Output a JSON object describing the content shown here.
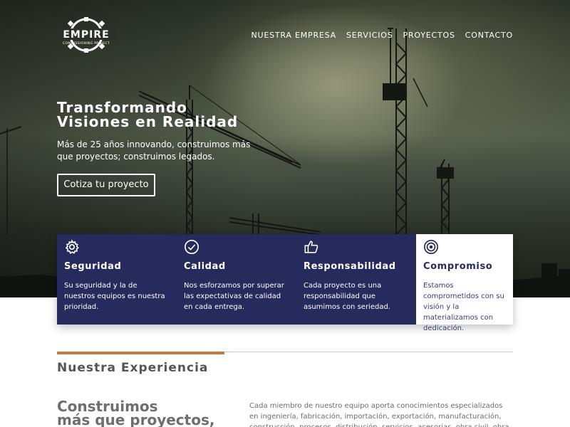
{
  "brand": {
    "logo_text": "EMPIRE",
    "logo_sub": "COMMISSIONING PROJECT"
  },
  "nav": {
    "items": [
      "NUESTRA EMPRESA",
      "SERVICIOS",
      "PROYECTOS",
      "CONTACTO"
    ]
  },
  "hero": {
    "title_line1": "Transformando",
    "title_line2": "Visiones en Realidad",
    "subtitle": "Más de 25 años innovando, construimos más que proyectos; construimos legados.",
    "cta_label": "Cotiza tu proyecto"
  },
  "features": [
    {
      "icon": "gear-icon",
      "title": "Seguridad",
      "text": "Su seguridad y la de nuestros equipos es nuestra prioridad."
    },
    {
      "icon": "checkmark-circle-icon",
      "title": "Calidad",
      "text": "Nos esforzamos por superar las expectativas de calidad en cada entrega."
    },
    {
      "icon": "thumbs-up-icon",
      "title": "Responsabilidad",
      "text": "Cada proyecto es una responsabilidad que asumimos con seriedad."
    },
    {
      "icon": "target-icon",
      "title": "Compromiso",
      "text": "Estamos comprometidos con su visión y la materializamos con dedicación."
    }
  ],
  "experience": {
    "heading": "Nuestra Experiencia",
    "big_title_line1": "Construimos",
    "big_title_line2": "más que proyectos,",
    "body": "Cada miembro de nuestro equipo aporta conocimientos especializados en ingeniería, fabricación, importación, exportación, manufacturación, construcción, procesos, distribución, servicios, acesorias, obra civil, obra mecánica, obra de tubería e hidráulica"
  },
  "colors": {
    "navy": "#262a5c",
    "accent": "#c47a44",
    "white": "#ffffff"
  }
}
